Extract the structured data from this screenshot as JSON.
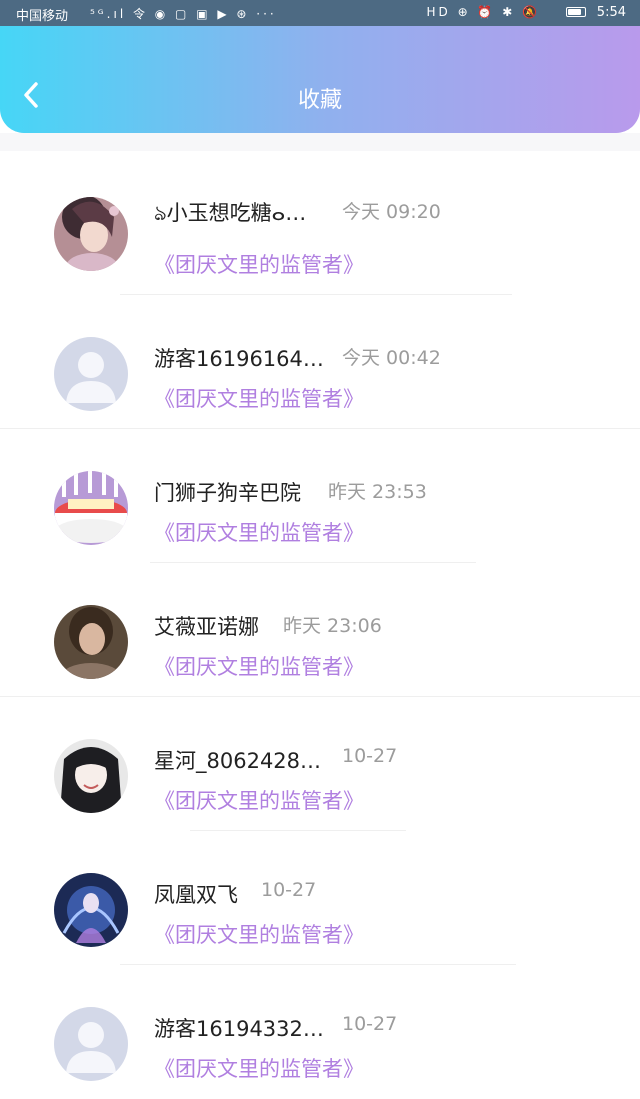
{
  "status_bar": {
    "carrier": "中国移动",
    "icons": "⁵ᴳ.ıl 令 ◉ ▢ ▣ ▶ ⊛ ···",
    "right_icons": "HD ⊕ ⏰ ✱ 🔕",
    "battery_level": 0.85,
    "time": "5:54"
  },
  "header": {
    "title": "收藏",
    "back_icon": "chevron-left-icon"
  },
  "colors": {
    "header_gradient_start": "#46d6f6",
    "header_gradient_end": "#b99aec",
    "book_title": "#b07fe0",
    "time_text": "#9c9c9c"
  },
  "items": [
    {
      "name": "ঌ小玉想吃糖ⴰ…",
      "time": "今天 09:20",
      "book": "《团厌文里的监管者》",
      "avatar": "avatar-anime-girl"
    },
    {
      "name": "游客16196164…",
      "time": "今天 00:42",
      "book": "《团厌文里的监管者》",
      "avatar": "avatar-default"
    },
    {
      "name": "门狮子狗辛巴院",
      "time": "昨天 23:53",
      "book": "《团厌文里的监管者》",
      "avatar": "avatar-cake"
    },
    {
      "name": "艾薇亚诺娜",
      "time": "昨天 23:06",
      "book": "《团厌文里的监管者》",
      "avatar": "avatar-girl-photo"
    },
    {
      "name": "星河_8062428…",
      "time": "10-27",
      "book": "《团厌文里的监管者》",
      "avatar": "avatar-anime-black-hair"
    },
    {
      "name": "凤凰双飞",
      "time": "10-27",
      "book": "《团厌文里的监管者》",
      "avatar": "avatar-blue-fantasy"
    },
    {
      "name": "游客16194332…",
      "time": "10-27",
      "book": "《团厌文里的监管者》",
      "avatar": "avatar-default"
    }
  ]
}
